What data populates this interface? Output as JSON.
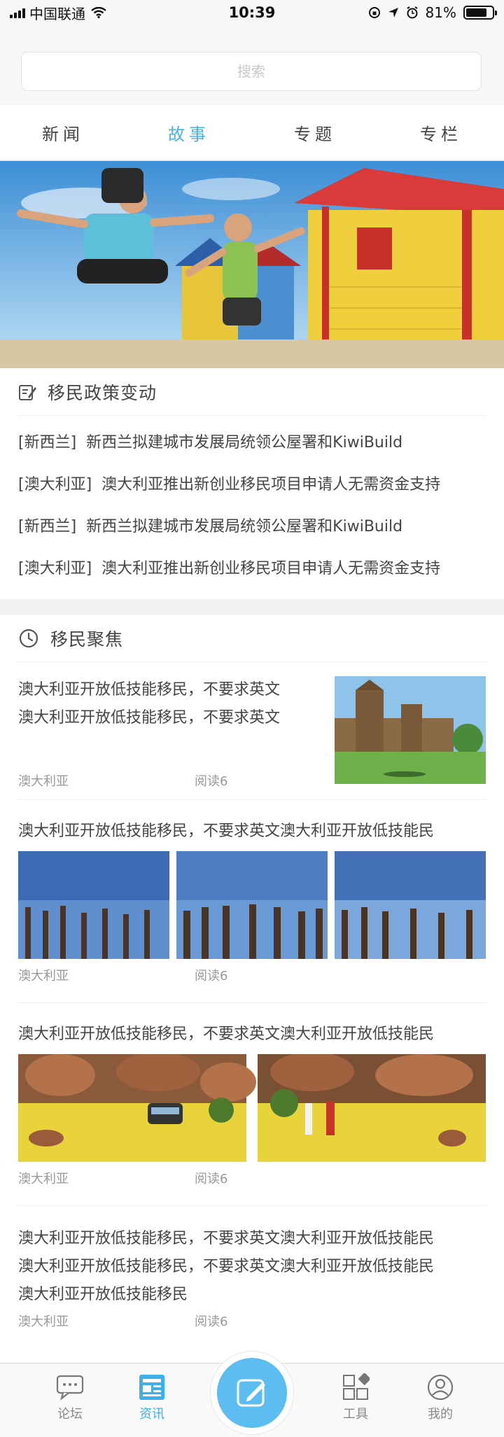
{
  "status_bar": {
    "carrier": "中国联通",
    "time": "10:39",
    "battery": "81%",
    "battery_level": 0.81
  },
  "search": {
    "placeholder": "搜索"
  },
  "tabs": [
    {
      "label": "新闻",
      "active": false
    },
    {
      "label": "故事",
      "active": true
    },
    {
      "label": "专题",
      "active": false
    },
    {
      "label": "专栏",
      "active": false
    }
  ],
  "policy_section": {
    "title": "移民政策变动",
    "items": [
      {
        "region": "[新西兰]",
        "title": "新西兰拟建城市发展局统领公屋署和KiwiBuild"
      },
      {
        "region": "[澳大利亚]",
        "title": "澳大利亚推出新创业移民项目申请人无需资金支持"
      },
      {
        "region": "[新西兰]",
        "title": "新西兰拟建城市发展局统领公屋署和KiwiBuild"
      },
      {
        "region": "[澳大利亚]",
        "title": "澳大利亚推出新创业移民项目申请人无需资金支持"
      }
    ]
  },
  "focus_section": {
    "title": "移民聚焦",
    "news": [
      {
        "line1": "澳大利亚开放低技能移民，不要求英文",
        "line2": "澳大利亚开放低技能移民，不要求英文",
        "region": "澳大利亚",
        "reads": "阅读6"
      },
      {
        "line1": "澳大利亚开放低技能移民，不要求英文澳大利亚开放低技能民",
        "region": "澳大利亚",
        "reads": "阅读6"
      },
      {
        "line1": "澳大利亚开放低技能移民，不要求英文澳大利亚开放低技能民",
        "region": "澳大利亚",
        "reads": "阅读6"
      },
      {
        "line1": "澳大利亚开放低技能移民，不要求英文澳大利亚开放低技能民",
        "line2": "澳大利亚开放低技能移民，不要求英文澳大利亚开放低技能民",
        "line3": "澳大利亚开放低技能移民",
        "region": "澳大利亚",
        "reads": "阅读6"
      }
    ]
  },
  "bottom_tabs": [
    {
      "label": "论坛",
      "icon": "forum-icon",
      "active": false
    },
    {
      "label": "资讯",
      "icon": "news-icon",
      "active": true
    },
    {
      "label": "工具",
      "icon": "tools-icon",
      "active": false
    },
    {
      "label": "我的",
      "icon": "profile-icon",
      "active": false
    }
  ],
  "publish_button": {
    "icon": "edit-icon"
  },
  "colors": {
    "accent": "#46b3e6",
    "publish": "#5cbdf0"
  }
}
